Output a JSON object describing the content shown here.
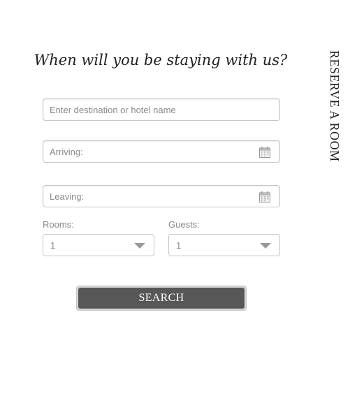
{
  "form": {
    "heading": "When will you be staying with us?",
    "side_tab_label": "RESERVE A ROOM",
    "destination": {
      "placeholder": "Enter destination or hotel name",
      "value": ""
    },
    "arriving": {
      "placeholder": "Arriving:",
      "value": "",
      "icon": "calendar-icon"
    },
    "leaving": {
      "placeholder": "Leaving:",
      "value": "",
      "icon": "calendar-icon"
    },
    "rooms": {
      "label": "Rooms:",
      "selected": "1"
    },
    "guests": {
      "label": "Guests:",
      "selected": "1"
    },
    "search_label": "SEARCH"
  },
  "colors": {
    "button_bg": "#575757",
    "button_text": "#ffffff",
    "field_border": "#c6c6c6",
    "placeholder": "#8a8a8a",
    "chevron": "#999999"
  }
}
